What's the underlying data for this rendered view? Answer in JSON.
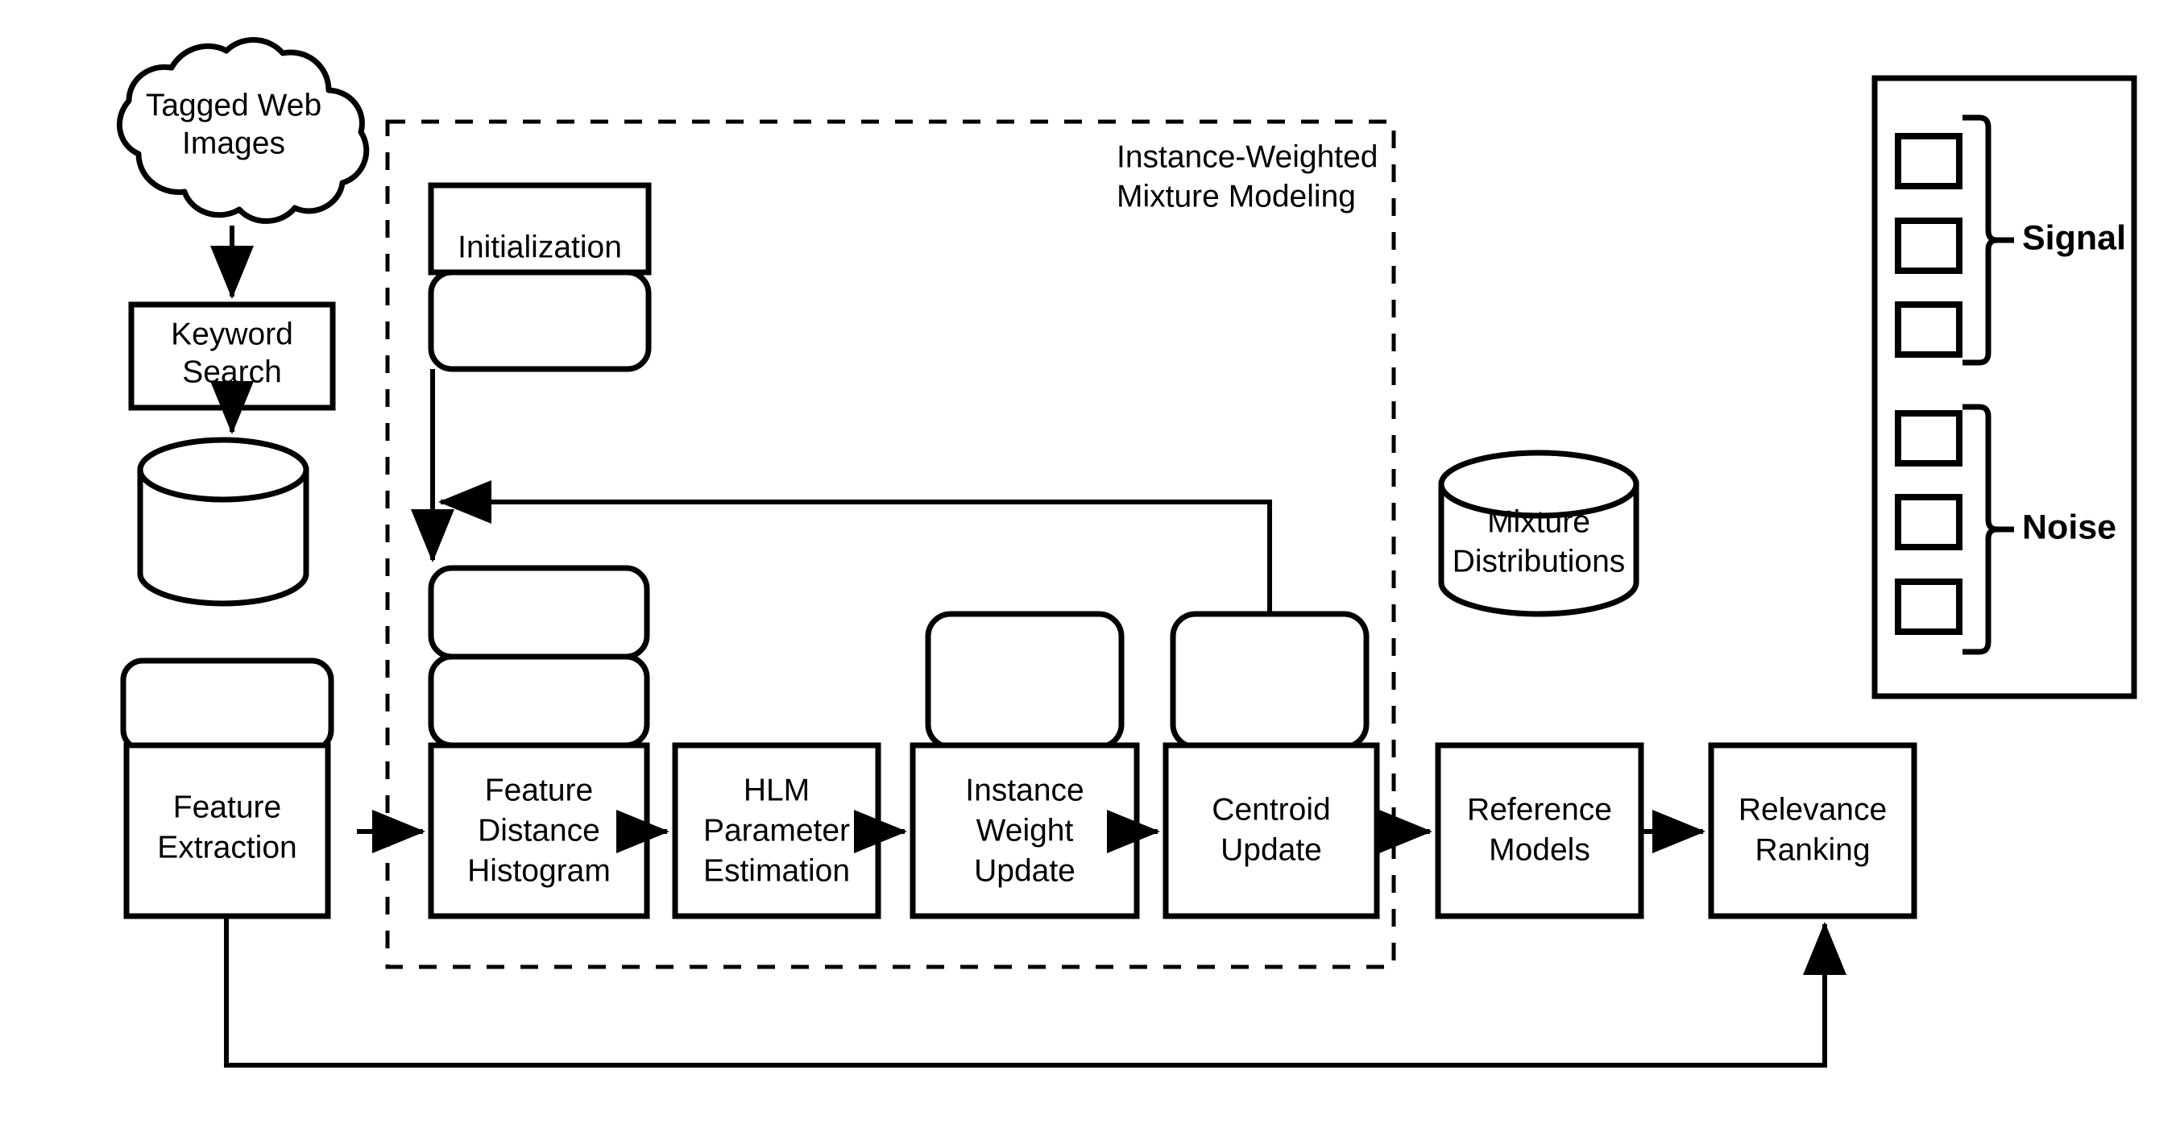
{
  "diagram": {
    "title": "Instance-Weighted Mixture Modeling pipeline",
    "source_cloud": {
      "label_line1": "Tagged Web",
      "label_line2": "Images"
    },
    "keyword_search": {
      "label_line1": "Keyword",
      "label_line2": "Search"
    },
    "image_database": {
      "label": ""
    },
    "feature_extraction": {
      "label_line1": "Feature",
      "label_line2": "Extraction"
    },
    "initialization": {
      "label": "Initialization"
    },
    "group_box": {
      "label_line1": "Instance-Weighted",
      "label_line2": "Mixture Modeling"
    },
    "feature_distance_histogram": {
      "label_line1": "Feature",
      "label_line2": "Distance",
      "label_line3": "Histogram"
    },
    "hlm_parameter_estimation": {
      "label_line1": "HLM",
      "label_line2": "Parameter",
      "label_line3": "Estimation"
    },
    "instance_weight_update": {
      "label_line1": "Instance",
      "label_line2": "Weight",
      "label_line3": "Update"
    },
    "centroid_update": {
      "label_line1": "Centroid",
      "label_line2": "Update"
    },
    "mixture_distributions": {
      "label_line1": "Mixture",
      "label_line2": "Distributions"
    },
    "reference_models": {
      "label_line1": "Reference",
      "label_line2": "Models"
    },
    "relevance_ranking": {
      "label_line1": "Relevance",
      "label_line2": "Ranking"
    },
    "legend": {
      "signal_label": "Signal",
      "noise_label": "Noise",
      "signal_item_count": 3,
      "noise_item_count": 3
    },
    "colors": {
      "stroke": "#000000",
      "fill": "#ffffff",
      "background": "#ffffff"
    }
  }
}
